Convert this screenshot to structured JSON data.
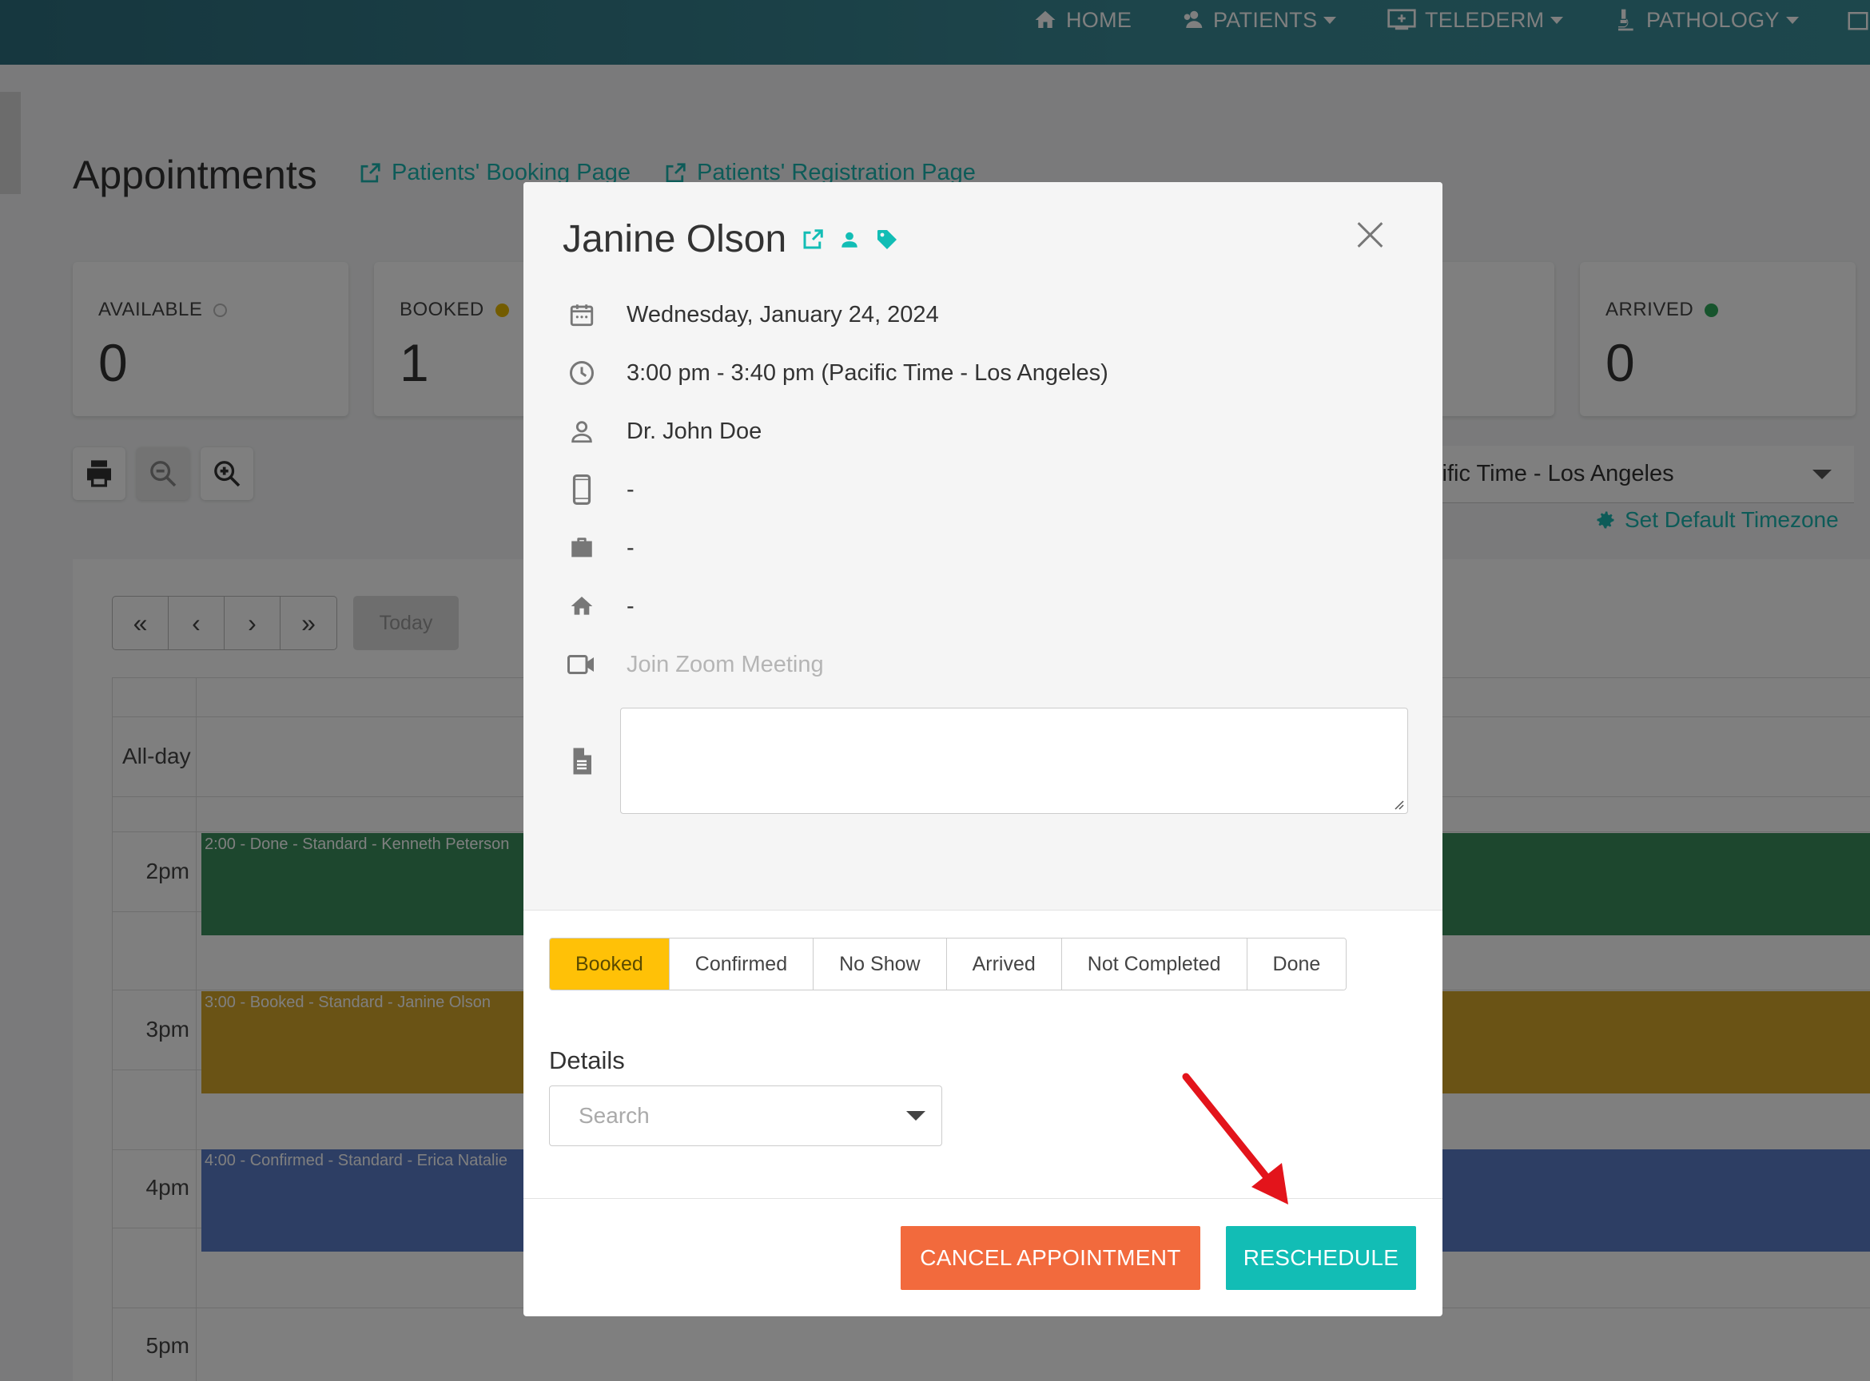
{
  "nav": {
    "home": "HOME",
    "patients": "PATIENTS",
    "telederm": "TELEDERM",
    "pathology": "PATHOLOGY"
  },
  "page": {
    "title": "Appointments",
    "booking_link": "Patients' Booking Page",
    "registration_link": "Patients' Registration Page"
  },
  "stats": [
    {
      "label": "AVAILABLE",
      "value": "0",
      "dot_color": "transparent"
    },
    {
      "label": "BOOKED",
      "value": "1",
      "dot_color": "#e6b800"
    },
    {
      "label": "ARRIVED",
      "value": "0",
      "dot_color": "#2fa85a"
    }
  ],
  "timezone": {
    "selected": "cific Time - Los Angeles",
    "set_default": "Set Default Timezone"
  },
  "calendar": {
    "nav": [
      "«",
      "‹",
      "›",
      "»"
    ],
    "today": "Today",
    "allday": "All-day",
    "times": [
      "2pm",
      "3pm",
      "4pm",
      "5pm"
    ],
    "events": [
      {
        "label": "2:00 - Done - Standard - Kenneth Peterson",
        "color": "#3a8f5c"
      },
      {
        "label": "3:00 - Booked - Standard - Janine Olson",
        "color": "#d4a62a"
      },
      {
        "label": "4:00 - Confirmed - Standard - Erica Natalie",
        "color": "#5a7cc9"
      }
    ]
  },
  "modal": {
    "patient_name": "Janine Olson",
    "date": "Wednesday, January 24, 2024",
    "time": "3:00 pm - 3:40 pm (Pacific Time - Los Angeles)",
    "provider": "Dr. John Doe",
    "phone": "-",
    "work": "-",
    "home": "-",
    "zoom": "Join Zoom Meeting",
    "notes": "",
    "statuses": [
      "Booked",
      "Confirmed",
      "No Show",
      "Arrived",
      "Not Completed",
      "Done"
    ],
    "active_status": "Booked",
    "details_label": "Details",
    "details_placeholder": "Search",
    "cancel_button": "CANCEL APPOINTMENT",
    "reschedule_button": "RESCHEDULE"
  },
  "colors": {
    "accent": "#12bdb5",
    "cancel": "#f26a3d",
    "booked": "#ffc107",
    "annotation_arrow": "#e3141b"
  }
}
